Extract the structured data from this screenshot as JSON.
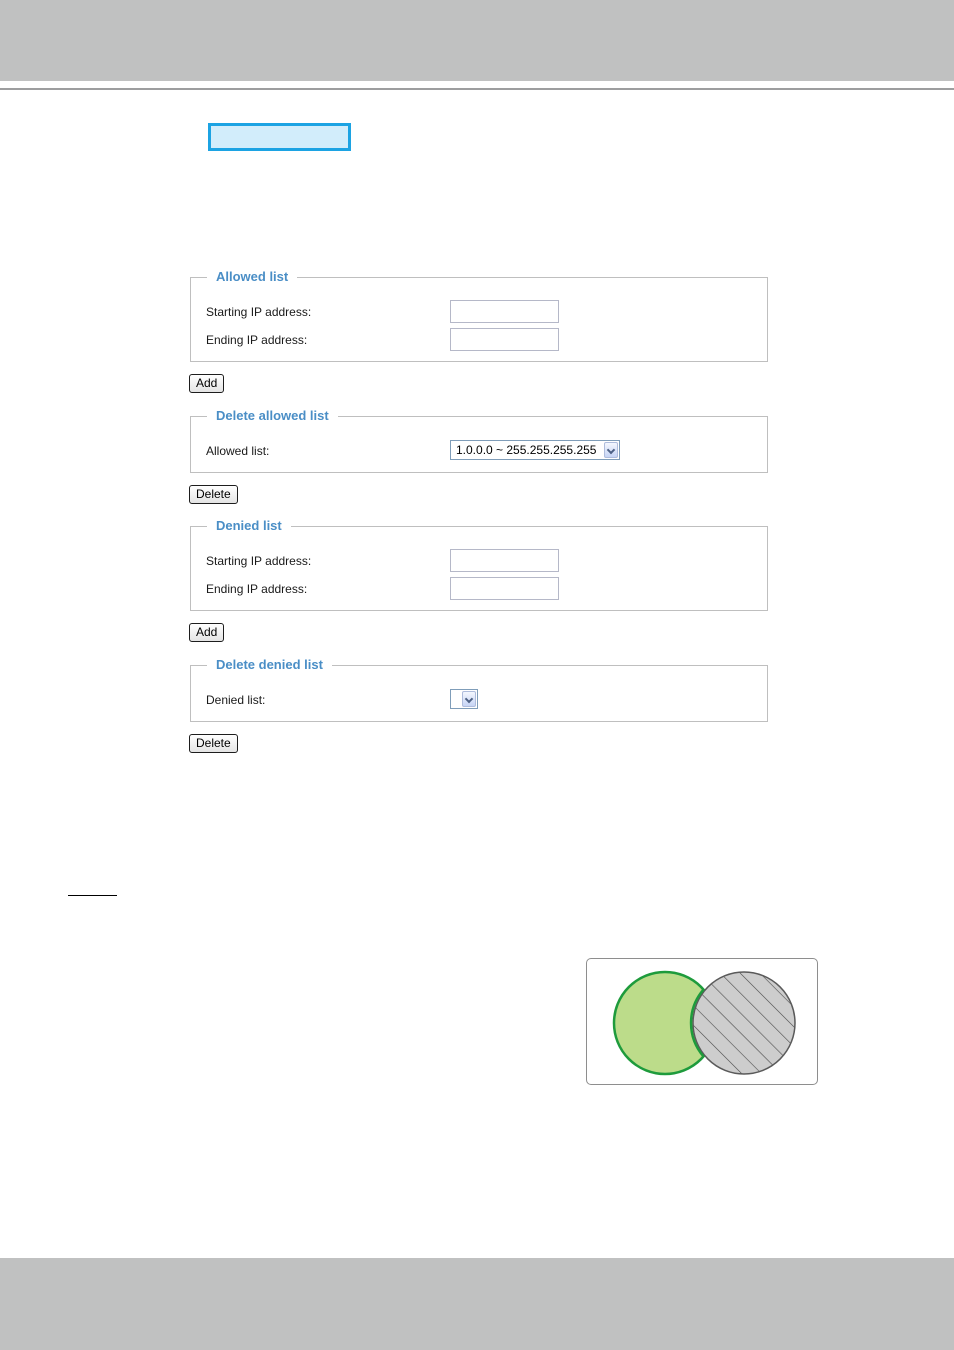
{
  "allowed_list_section": {
    "legend": "Allowed list",
    "starting_ip_label": "Starting IP address:",
    "starting_ip_value": "",
    "ending_ip_label": "Ending IP address:",
    "ending_ip_value": "",
    "add_button": "Add"
  },
  "delete_allowed_section": {
    "legend": "Delete allowed list",
    "list_label": "Allowed list:",
    "selected_value": "1.0.0.0 ~ 255.255.255.255",
    "delete_button": "Delete"
  },
  "denied_list_section": {
    "legend": "Denied list",
    "starting_ip_label": "Starting IP address:",
    "starting_ip_value": "",
    "ending_ip_label": "Ending IP address:",
    "ending_ip_value": "",
    "add_button": "Add"
  },
  "delete_denied_section": {
    "legend": "Delete denied list",
    "list_label": "Denied list:",
    "selected_value": "",
    "delete_button": "Delete"
  },
  "colors": {
    "band_gray": "#c0c1c1",
    "highlight_border": "#1ca3e3",
    "highlight_fill": "#d2edfb",
    "legend_blue": "#4a8ec6",
    "allowed_circle_fill": "#bcdc8a",
    "allowed_circle_stroke": "#1e9b3c",
    "denied_circle_fill": "#cdcdcd"
  },
  "diagram": {
    "allowed_circle": "allowed-set-circle",
    "denied_circle": "denied-set-circle-hatched"
  }
}
